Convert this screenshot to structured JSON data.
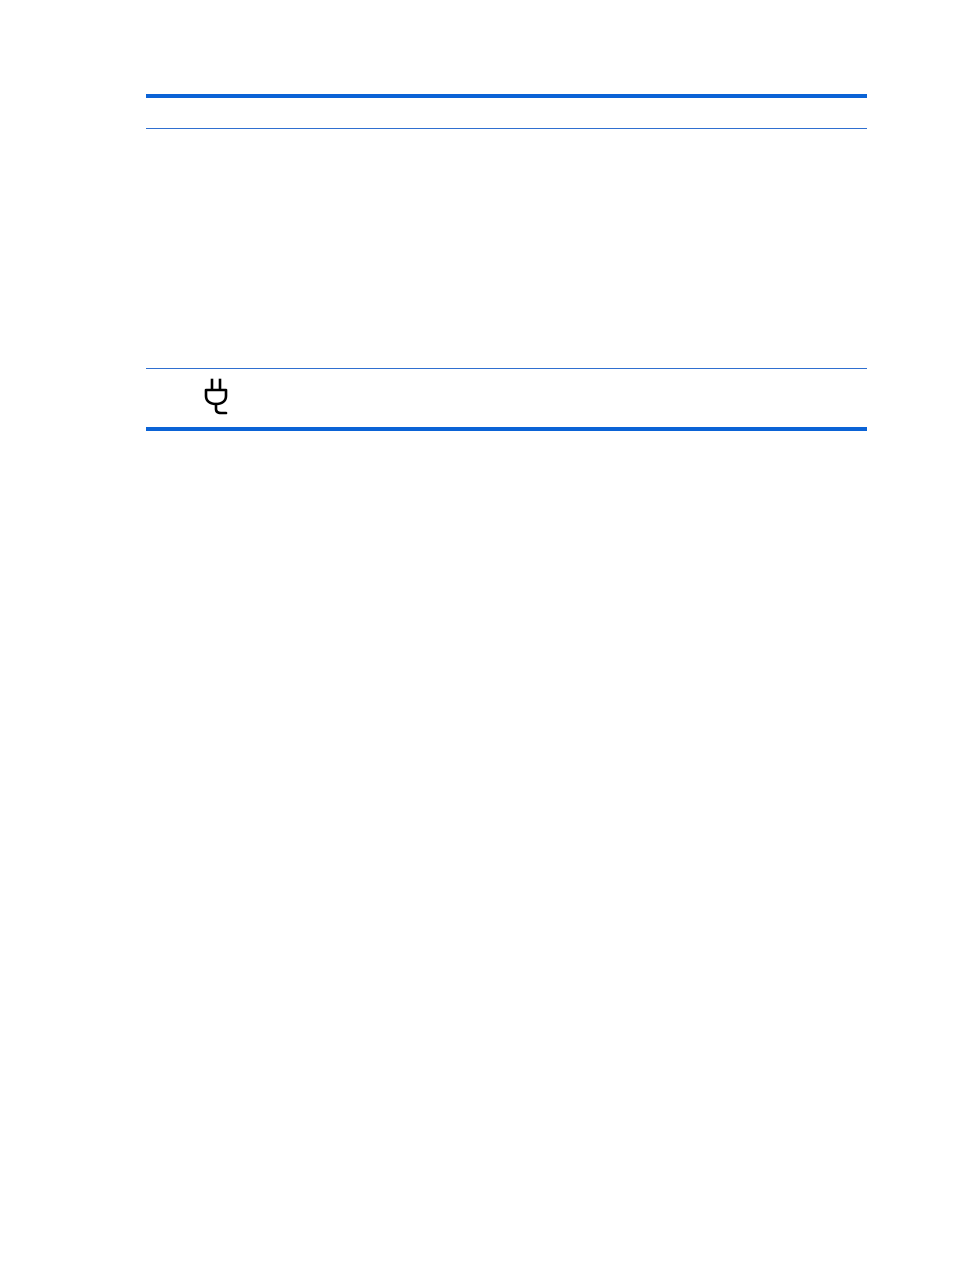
{
  "table": {
    "header": [],
    "rows": [
      {
        "icon": null
      },
      {
        "icon": "power-plug-icon"
      }
    ]
  },
  "colors": {
    "rule": "#0b63d6",
    "thin_rule": "#2f6fd0",
    "icon": "#000000"
  }
}
